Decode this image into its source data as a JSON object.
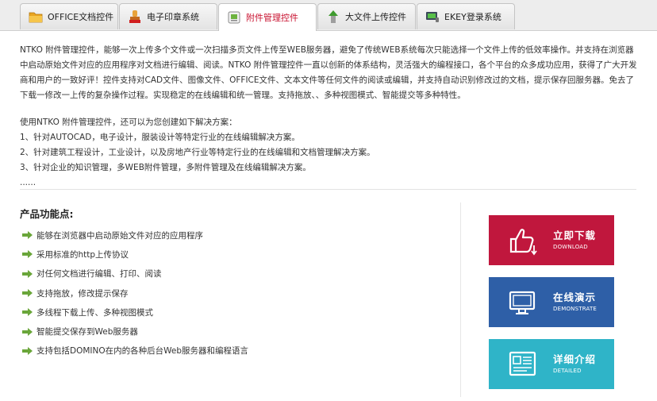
{
  "tabs": [
    {
      "label": "OFFICE文档控件",
      "icon": "folder-icon",
      "active": false
    },
    {
      "label": "电子印章系统",
      "icon": "seal-icon",
      "active": false
    },
    {
      "label": "附件管理控件",
      "icon": "attachment-icon",
      "active": true
    },
    {
      "label": "大文件上传控件",
      "icon": "upload-icon",
      "active": false
    },
    {
      "label": "EKEY登录系统",
      "icon": "ekey-icon",
      "active": false
    }
  ],
  "intro": {
    "paragraph": "NTKO 附件管理控件，能够一次上传多个文件或一次扫描多页文件上传至WEB服务器，避免了传统WEB系统每次只能选择一个文件上传的低效率操作。并支持在浏览器中启动原始文件对应的应用程序对文档进行编辑、阅读。NTKO 附件管理控件一直以创新的体系结构，灵活强大的编程接口，各个平台的众多成功应用，获得了广大开发商和用户的一致好评！控件支持对CAD文件、图像文件、OFFICE文件、文本文件等任何文件的阅读或编辑，并支持自动识别修改过的文档，提示保存回服务器。免去了下载一修改一上传的复杂操作过程。实现稳定的在线编辑和统一管理。支持拖放、、多种视图模式、智能提交等多种特性。",
    "solutions_lead": "使用NTKO 附件管理控件，还可以为您创建如下解决方案：",
    "solutions": [
      "1、针对AUTOCAD，电子设计，服装设计等特定行业的在线编辑解决方案。",
      "2、针对建筑工程设计，工业设计，以及房地产行业等特定行业的在线编辑和文档管理解决方案。",
      "3、针对企业的知识管理，多WEB附件管理，多附件管理及在线编辑解决方案。"
    ],
    "ellipsis": "......"
  },
  "features": {
    "title": "产品功能点:",
    "items": [
      "能够在浏览器中启动原始文件对应的应用程序",
      "采用标准的http上传协议",
      "对任何文档进行编辑、打印、阅读",
      "支持拖放，修改提示保存",
      "多线程下载上传、多种视图模式",
      "智能提交保存到Web服务器",
      "支持包括DOMINO在内的各种后台Web服务器和编程语言"
    ]
  },
  "promos": {
    "download": {
      "cn": "立即下载",
      "en": "DOWNLOAD",
      "icon": "thumbs-up-download-icon"
    },
    "demo": {
      "cn": "在线演示",
      "en": "DEMONSTRATE",
      "icon": "monitor-icon"
    },
    "detail": {
      "cn": "详细介绍",
      "en": "DETAILED",
      "icon": "document-card-icon"
    }
  },
  "colors": {
    "active_tab_text": "#c8102e",
    "download_bg": "#c0173d",
    "demo_bg": "#2e5fa7",
    "detail_bg": "#2fb4c8",
    "bullet_arrow": "#6aa63a"
  }
}
